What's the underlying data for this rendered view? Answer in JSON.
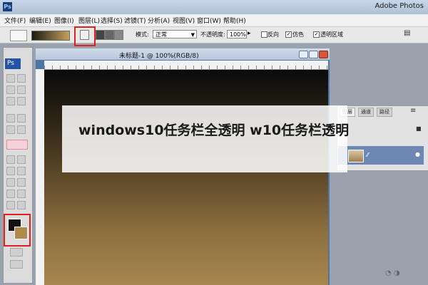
{
  "window": {
    "title": "Adobe Photos",
    "app_badge": "Ps"
  },
  "menu": [
    "文件(F)",
    "编辑(E)",
    "图像(I)",
    "图层(L)",
    "选择(S)",
    "滤镜(T)",
    "分析(A)",
    "视图(V)",
    "窗口(W)",
    "帮助(H)"
  ],
  "options": {
    "mode_label": "模式:",
    "mode_value": "正常",
    "opacity_label": "不透明度:",
    "opacity_value": "100%",
    "reverse_label": "反向",
    "dither_label": "仿色",
    "transparency_label": "透明区域"
  },
  "document": {
    "title": "未标题-1 @ 100%(RGB/8)"
  },
  "panels": {
    "tabs": [
      "图层",
      "通道",
      "路径"
    ]
  },
  "overlay": {
    "title": "windows10任务栏全透明 w10任务栏透明"
  },
  "colors": {
    "foreground": "#111111",
    "background": "#b08a4c",
    "highlight": "#e02020"
  }
}
